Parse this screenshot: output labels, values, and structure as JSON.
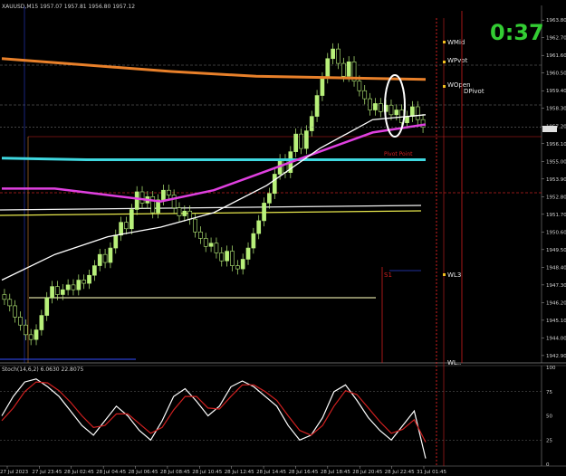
{
  "window": {
    "title": "XAUUSD,M15",
    "ohlc_text": "XAUUSD,M15  1957.07 1957.81 1956.80 1957.12",
    "osc_text": "Stoch(14,6,2) 6.0630 22.8075",
    "timer": "0:37",
    "level_labels": [
      "WMid",
      "WPvot",
      "WOpen",
      "DPivot",
      "WL3",
      "WL.."
    ],
    "red_axis_label": "S1",
    "red_small_text": "Pivot Point"
  },
  "colors": {
    "bg": "#000000",
    "candle": "#b8f07a",
    "orange_ma": "#e8802a",
    "yellow_line": "#e8e84c",
    "cream_line": "#f6d9b0",
    "cyan_ma": "#3fd8e0",
    "magenta_ma": "#e040e0",
    "blue_ma": "#2a3fd0",
    "white_line": "#ffffff",
    "red_level": "#d02020",
    "timer": "#33cc33",
    "stoch_main": "#ffffff",
    "stoch_signal": "#d02020"
  },
  "chart_data": [
    {
      "type": "line",
      "title": "XAUUSD,M15",
      "xlabel": "",
      "ylabel": "",
      "x_ticks": [
        "27 Jul 2023",
        "27 Jul 23:45",
        "28 Jul 02:45",
        "28 Jul 04:45",
        "28 Jul 06:45",
        "28 Jul 08:45",
        "28 Jul 10:45",
        "28 Jul 12:45",
        "28 Jul 14:45",
        "28 Jul 16:45",
        "28 Jul 18:45",
        "28 Jul 20:45",
        "28 Jul 22:45",
        "31 Jul 01:45"
      ],
      "y_ticks": [
        1942.9,
        1944.0,
        1945.1,
        1946.2,
        1947.3,
        1948.4,
        1949.5,
        1950.6,
        1951.7,
        1952.8,
        1953.9,
        1955.0,
        1956.1,
        1957.2,
        1958.3,
        1959.4,
        1960.5,
        1961.6,
        1962.7,
        1963.8
      ],
      "ylim": [
        1942.5,
        1964.6
      ],
      "current_price": 1957.12,
      "candle_close": [
        1946.4,
        1946.0,
        1945.3,
        1944.8,
        1944.2,
        1943.9,
        1944.5,
        1945.4,
        1946.5,
        1947.2,
        1946.7,
        1947.0,
        1947.3,
        1947.0,
        1947.6,
        1947.4,
        1947.9,
        1948.5,
        1949.2,
        1948.7,
        1949.6,
        1950.4,
        1951.2,
        1950.8,
        1952.0,
        1953.1,
        1952.4,
        1952.8,
        1951.8,
        1952.6,
        1953.2,
        1952.9,
        1952.1,
        1951.6,
        1951.9,
        1951.4,
        1950.6,
        1950.2,
        1949.7,
        1949.9,
        1949.3,
        1948.8,
        1949.4,
        1948.5,
        1948.3,
        1948.9,
        1949.6,
        1950.5,
        1951.3,
        1952.4,
        1953.0,
        1954.2,
        1955.1,
        1954.3,
        1955.6,
        1956.7,
        1955.8,
        1956.9,
        1957.8,
        1959.1,
        1960.2,
        1961.4,
        1962.0,
        1961.1,
        1960.3,
        1961.2,
        1960.0,
        1959.4,
        1958.9,
        1958.2,
        1958.6,
        1958.1,
        1958.5,
        1957.9,
        1958.2,
        1957.4,
        1957.8,
        1958.4,
        1957.6,
        1957.12
      ],
      "series": [
        {
          "name": "",
          "values": [
            1955.2,
            1955.1,
            1955.1,
            1955.1,
            1955.1,
            1955.1
          ]
        },
        {
          "name": "",
          "values": [
            1961.4,
            1961.0,
            1960.6,
            1960.3,
            1960.2,
            1960.1
          ]
        },
        {
          "name": "",
          "values": [
            1953.3,
            1953.3,
            1952.9,
            1952.5,
            1953.2,
            1954.4,
            1955.6,
            1956.8,
            1957.3
          ]
        },
        {
          "name": "",
          "values": [
            1947.6,
            1949.2,
            1950.3,
            1950.9,
            1951.8,
            1953.5,
            1955.8,
            1957.6,
            1957.9
          ]
        }
      ]
    },
    {
      "type": "line",
      "title": "Stoch(14,6,2) 6.0630 22.8075",
      "y_ticks": [
        0,
        25,
        50,
        75,
        100
      ],
      "ylim": [
        0,
        100
      ],
      "series": [
        {
          "name": "",
          "values": [
            50,
            70,
            85,
            88,
            80,
            70,
            55,
            40,
            30,
            45,
            60,
            50,
            35,
            25,
            45,
            70,
            78,
            65,
            50,
            60,
            80,
            86,
            80,
            70,
            60,
            40,
            25,
            30,
            48,
            75,
            82,
            66,
            48,
            35,
            25,
            40,
            55,
            6
          ]
        },
        {
          "name": "",
          "values": [
            45,
            58,
            75,
            85,
            84,
            76,
            64,
            50,
            38,
            40,
            52,
            52,
            42,
            32,
            38,
            56,
            70,
            70,
            58,
            57,
            70,
            82,
            82,
            75,
            66,
            50,
            35,
            30,
            40,
            60,
            76,
            72,
            58,
            44,
            32,
            36,
            46,
            22.8
          ]
        }
      ]
    }
  ]
}
